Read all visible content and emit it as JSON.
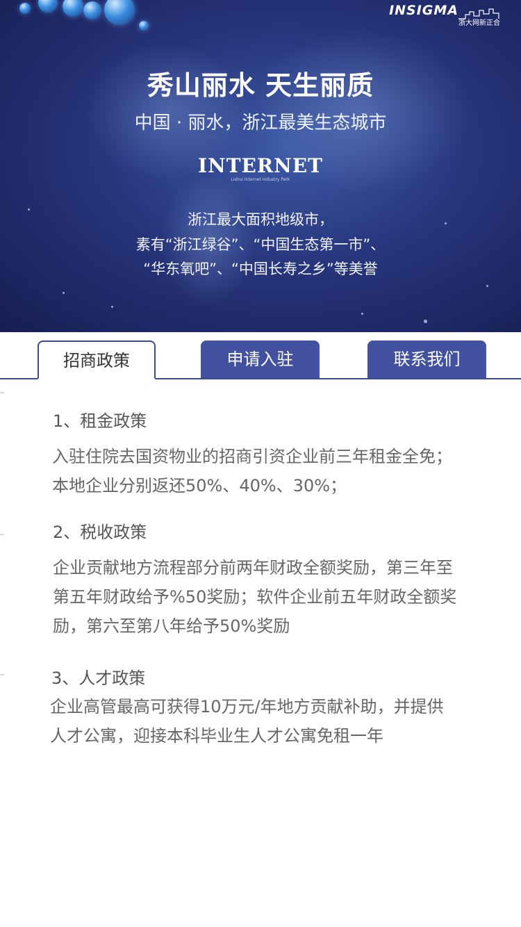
{
  "banner": {
    "logo": {
      "brand": "INSIGMA",
      "subtitle": "浙大网新正合"
    },
    "title": "秀山丽水 天生丽质",
    "subtitle": "中国 · 丽水，浙江最美生态城市",
    "internet": {
      "title": "INTERNET",
      "subtitle": "Lishui Internet Industry Park"
    },
    "desc_lines": [
      "浙江最大面积地级市，",
      "素有“浙江绿谷”、“中国生态第一市”、",
      "“华东氧吧”、“中国长寿之乡”等美誉"
    ]
  },
  "tabs": [
    {
      "label": "招商政策",
      "active": true
    },
    {
      "label": "申请入驻",
      "active": false
    },
    {
      "label": "联系我们",
      "active": false
    }
  ],
  "policies": [
    {
      "heading": "1、租金政策",
      "lines": [
        "入驻住院去国资物业的招商引资企业前三年租金全免；",
        "本地企业分别返还50%、40%、30%；"
      ]
    },
    {
      "heading": "2、税收政策",
      "lines": [
        "企业贡献地方流程部分前两年财政全额奖励，第三年至",
        "第五年财政给予%50奖励；软件企业前五年财政全额奖",
        "励，第六至第八年给予50%奖励"
      ]
    },
    {
      "heading": "3、人才政策",
      "lines": [
        "企业高管最高可获得10万元/年地方贡献补助，并提供",
        "人才公寓，迎接本科毕业生人才公寓免租一年"
      ]
    }
  ],
  "colors": {
    "tab_active_border": "#3a4a8c",
    "tab_inactive_bg": "#4352a0",
    "banner_bg": "#27357c"
  }
}
